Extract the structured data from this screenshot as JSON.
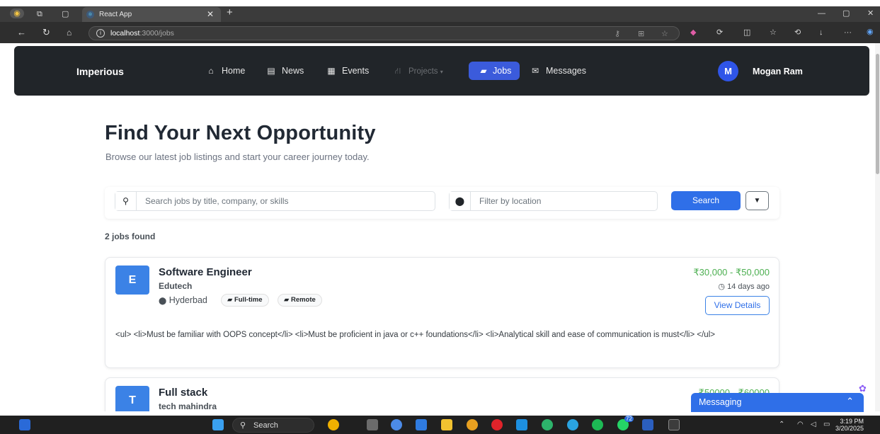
{
  "browser": {
    "tab_title": "React App",
    "url_host": "localhost",
    "url_path": ":3000/jobs"
  },
  "navbar": {
    "brand": "Imperious",
    "items": [
      {
        "label": "Home",
        "icon": "home-icon"
      },
      {
        "label": "News",
        "icon": "newspaper-icon"
      },
      {
        "label": "Events",
        "icon": "calendar-icon"
      },
      {
        "label": "Projects",
        "icon": "project-diagram-icon"
      },
      {
        "label": "Jobs",
        "icon": "briefcase-icon"
      },
      {
        "label": "Messages",
        "icon": "envelope-icon"
      }
    ],
    "user": {
      "initial": "M",
      "name": "Mogan Ram"
    }
  },
  "hero": {
    "title": "Find Your Next Opportunity",
    "subtitle": "Browse our latest job listings and start your career journey today."
  },
  "search": {
    "keyword_placeholder": "Search jobs by title, company, or skills",
    "location_placeholder": "Filter by location",
    "search_label": "Search"
  },
  "results": {
    "count_text": "2 jobs found"
  },
  "jobs": [
    {
      "logo_letter": "E",
      "title": "Software Engineer",
      "company": "Edutech",
      "location": "Hyderbad",
      "type": "Full-time",
      "mode": "Remote",
      "salary": "₹30,000 - ₹50,000",
      "posted": "14 days ago",
      "view_label": "View Details",
      "description": "<ul> <li>Must be familiar with OOPS concept</li> <li>Must be proficient in java or c++ foundations</li> <li>Analytical skill and ease of communication is must</li> </ul>"
    },
    {
      "logo_letter": "T",
      "title": "Full stack",
      "company": "tech mahindra",
      "salary": "₹50000 - ₹60000"
    }
  ],
  "messaging": {
    "label": "Messaging"
  },
  "taskbar": {
    "search_label": "Search",
    "time": "3:19 PM",
    "date": "3/20/2025",
    "badge": "72"
  },
  "colors": {
    "navbar_bg": "#212529",
    "accent": "#2f6fe8",
    "salary_green": "#4caf50"
  }
}
